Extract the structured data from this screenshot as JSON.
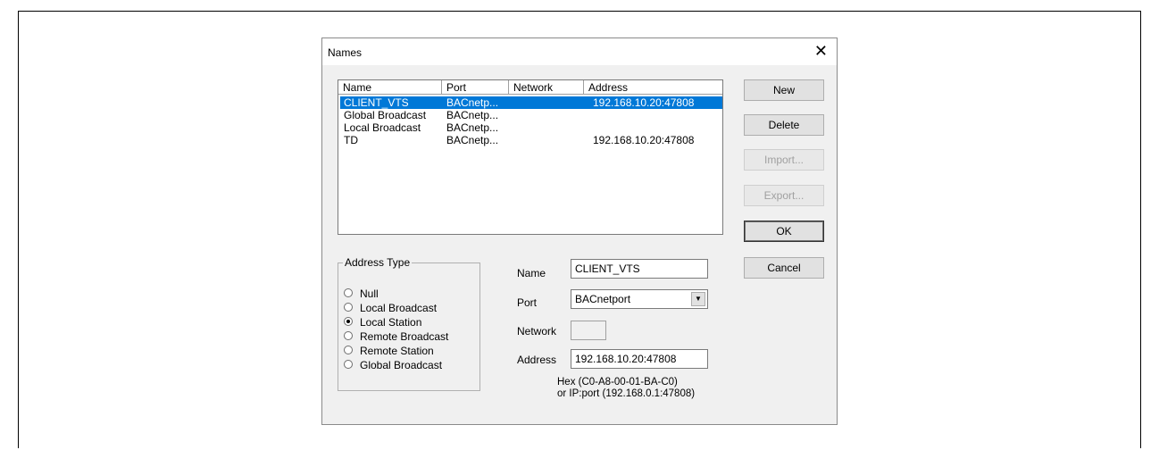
{
  "dialog": {
    "title": "Names",
    "close_glyph": "✕"
  },
  "listview": {
    "columns": [
      "Name",
      "Port",
      "Network",
      "Address"
    ],
    "rows": [
      {
        "name": "CLIENT_VTS",
        "port": "BACnetp...",
        "network": "",
        "address": "192.168.10.20:47808",
        "selected": true
      },
      {
        "name": "Global Broadcast",
        "port": "BACnetp...",
        "network": "",
        "address": "",
        "selected": false
      },
      {
        "name": "Local Broadcast",
        "port": "BACnetp...",
        "network": "",
        "address": "",
        "selected": false
      },
      {
        "name": "TD",
        "port": "BACnetp...",
        "network": "",
        "address": "192.168.10.20:47808",
        "selected": false
      }
    ]
  },
  "buttons": {
    "new": "New",
    "delete": "Delete",
    "import": "Import...",
    "export": "Export...",
    "ok": "OK",
    "cancel": "Cancel"
  },
  "address_type": {
    "legend": "Address Type",
    "options": [
      "Null",
      "Local Broadcast",
      "Local Station",
      "Remote Broadcast",
      "Remote Station",
      "Global Broadcast"
    ],
    "selected": "Local Station"
  },
  "form": {
    "name_label": "Name",
    "name_value": "CLIENT_VTS",
    "port_label": "Port",
    "port_value": "BACnetport",
    "network_label": "Network",
    "network_value": "",
    "address_label": "Address",
    "address_value": "192.168.10.20:47808",
    "hint_line1": "Hex  (C0-A8-00-01-BA-C0)",
    "hint_line2": "or IP:port (192.168.0.1:47808)"
  },
  "colors": {
    "selection": "#0078d7",
    "dialog_bg": "#f0f0f0"
  }
}
